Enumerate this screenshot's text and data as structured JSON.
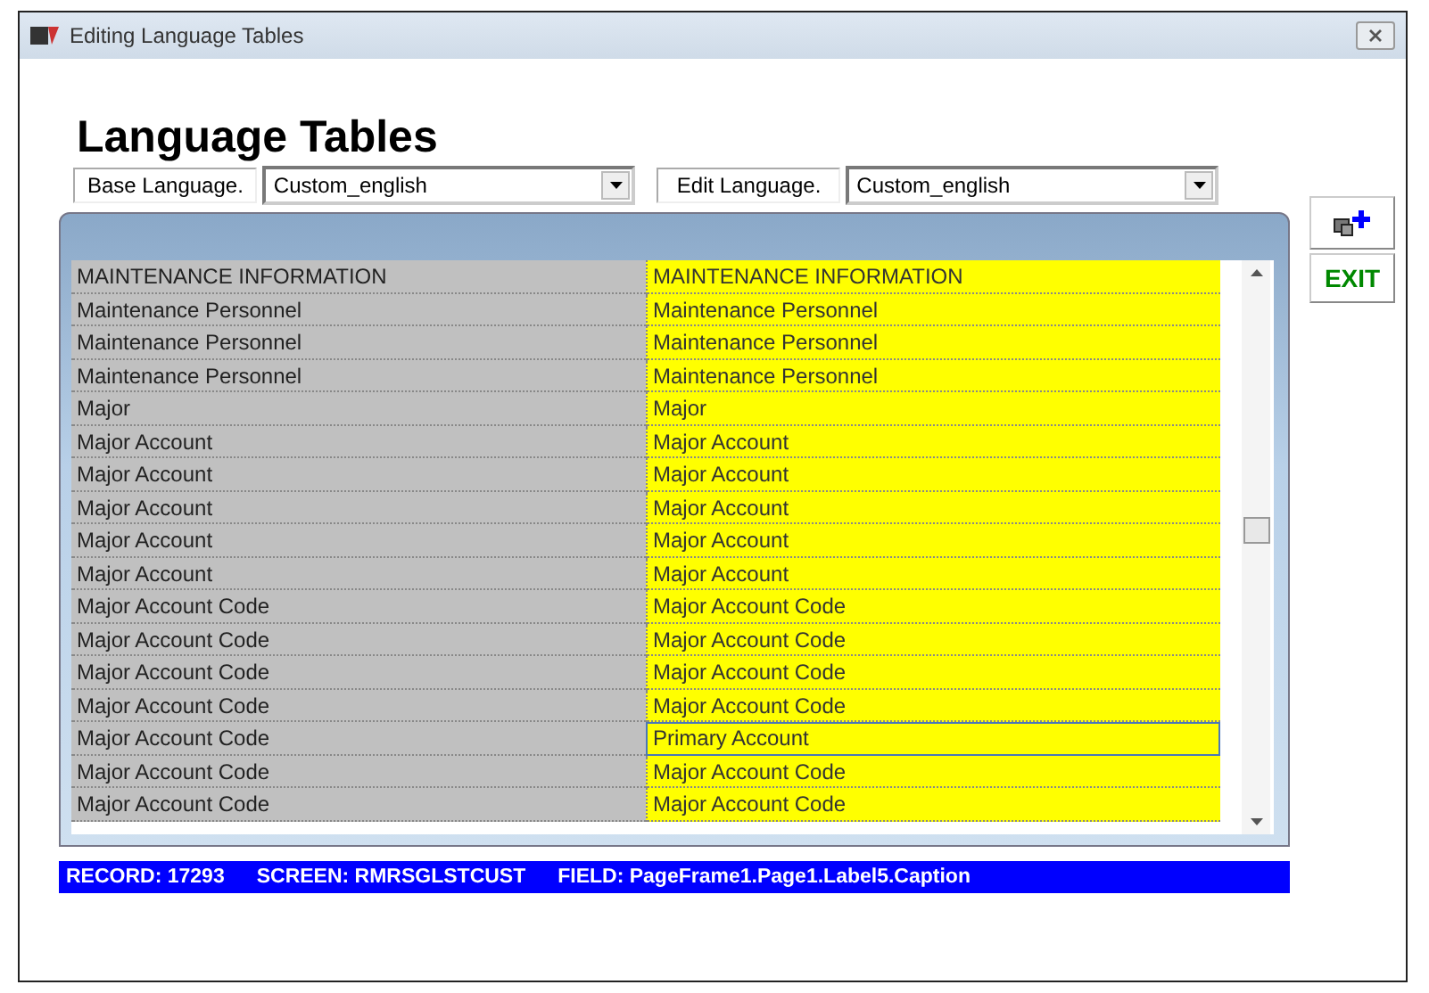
{
  "window": {
    "title": "Editing Language Tables"
  },
  "heading": "Language Tables",
  "base_language": {
    "label": "Base Language.",
    "value": "Custom_english"
  },
  "edit_language": {
    "label": "Edit Language.",
    "value": "Custom_english"
  },
  "buttons": [
    {
      "kind": "add"
    },
    {
      "kind": "exit",
      "label": "EXIT"
    }
  ],
  "rows": [
    {
      "base": "MAINTENANCE INFORMATION",
      "edit": "MAINTENANCE INFORMATION",
      "selected": false
    },
    {
      "base": "Maintenance Personnel",
      "edit": "Maintenance Personnel",
      "selected": false
    },
    {
      "base": "Maintenance Personnel",
      "edit": "Maintenance Personnel",
      "selected": false
    },
    {
      "base": "Maintenance Personnel",
      "edit": "Maintenance Personnel",
      "selected": false
    },
    {
      "base": "Major",
      "edit": "Major",
      "selected": false
    },
    {
      "base": "Major Account",
      "edit": "Major Account",
      "selected": false
    },
    {
      "base": "Major Account",
      "edit": "Major Account",
      "selected": false
    },
    {
      "base": "Major Account",
      "edit": "Major Account",
      "selected": false
    },
    {
      "base": "Major Account",
      "edit": "Major Account",
      "selected": false
    },
    {
      "base": "Major Account",
      "edit": "Major Account",
      "selected": false
    },
    {
      "base": "Major Account Code",
      "edit": "Major Account Code",
      "selected": false
    },
    {
      "base": "Major Account Code",
      "edit": "Major Account Code",
      "selected": false
    },
    {
      "base": "Major Account Code",
      "edit": "Major Account Code",
      "selected": false
    },
    {
      "base": "Major Account Code",
      "edit": "Major Account Code",
      "selected": false
    },
    {
      "base": "Major Account Code",
      "edit": "Primary Account",
      "selected": true
    },
    {
      "base": "Major Account Code",
      "edit": "Major Account Code",
      "selected": false
    },
    {
      "base": "Major Account Code",
      "edit": "Major Account Code",
      "selected": false
    }
  ],
  "status_bar": {
    "record": "RECORD: 17293",
    "screen": "SCREEN: RMRSGLSTCUST",
    "field": "FIELD: PageFrame1.Page1.Label5.Caption"
  }
}
